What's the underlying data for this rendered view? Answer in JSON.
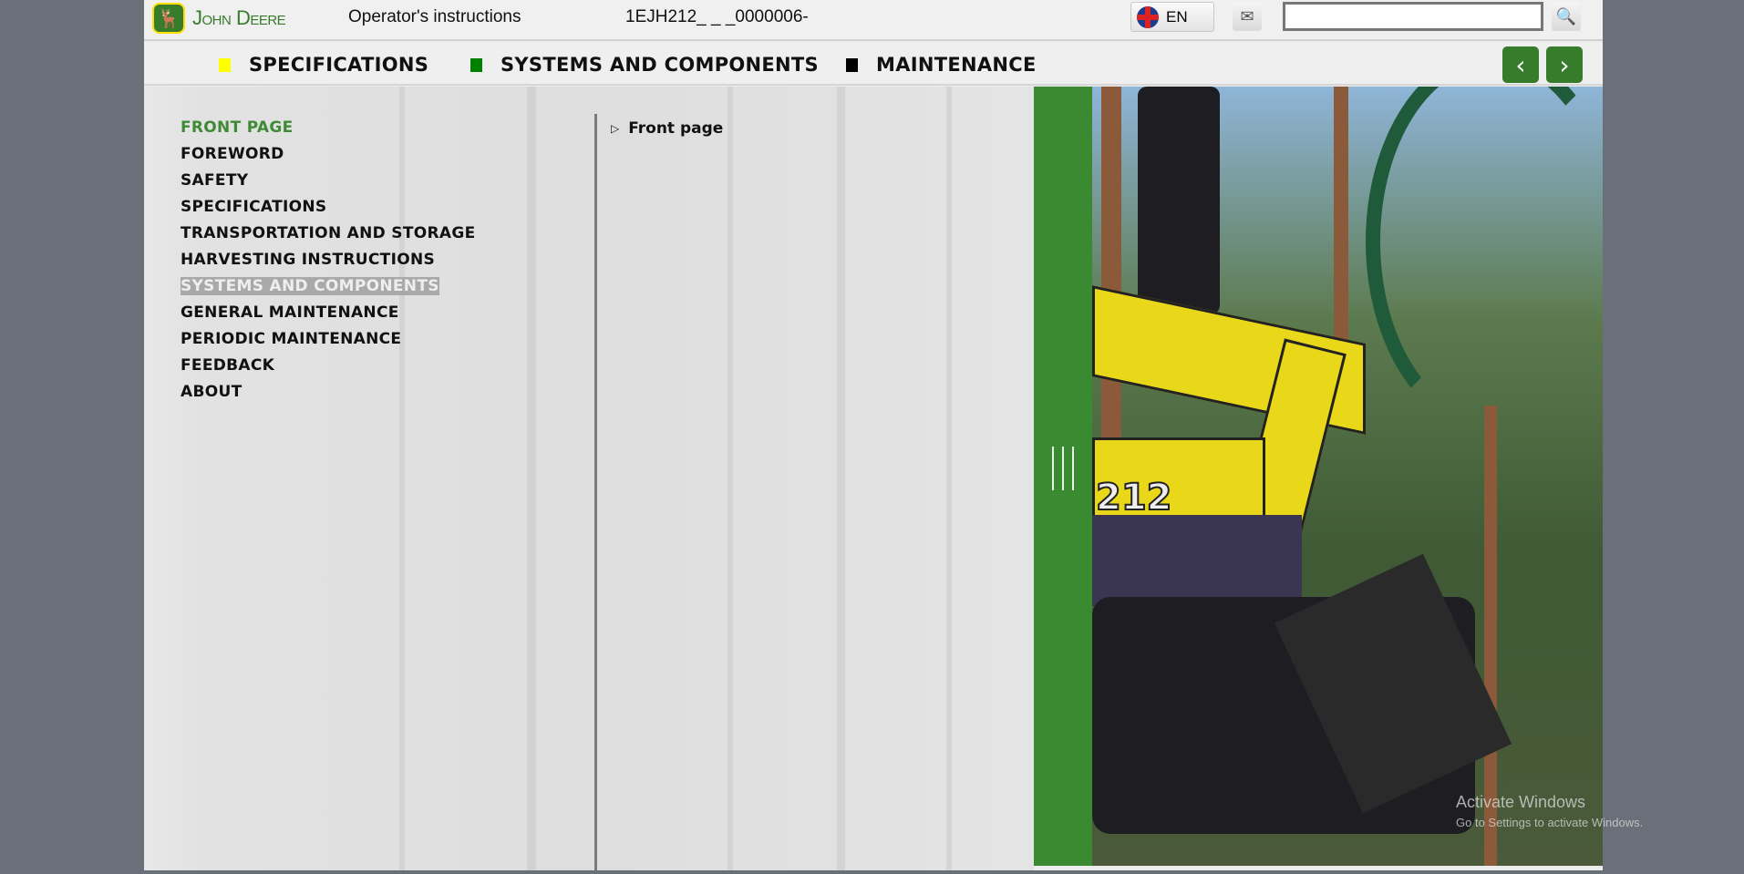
{
  "header": {
    "brand": "John Deere",
    "title": "Operator's instructions",
    "doc_code": "1EJH212_ _ _0000006-",
    "language": "EN",
    "search": {
      "value": "",
      "placeholder": ""
    }
  },
  "nav": {
    "items": [
      {
        "label": "SPECIFICATIONS",
        "color": "#ffff00"
      },
      {
        "label": "SYSTEMS AND COMPONENTS",
        "color": "#008000"
      },
      {
        "label": "MAINTENANCE",
        "color": "#000000"
      }
    ]
  },
  "menu": {
    "items": [
      {
        "label": "FRONT PAGE",
        "state": "active"
      },
      {
        "label": "FOREWORD"
      },
      {
        "label": "SAFETY"
      },
      {
        "label": "SPECIFICATIONS"
      },
      {
        "label": "TRANSPORTATION AND STORAGE"
      },
      {
        "label": "HARVESTING INSTRUCTIONS"
      },
      {
        "label": "SYSTEMS AND COMPONENTS",
        "state": "highlighted"
      },
      {
        "label": "GENERAL MAINTENANCE"
      },
      {
        "label": "PERIODIC MAINTENANCE"
      },
      {
        "label": "FEEDBACK"
      },
      {
        "label": "ABOUT"
      }
    ]
  },
  "breadcrumb": {
    "label": "Front page"
  },
  "photo": {
    "machine_number": "212"
  },
  "watermark": {
    "line1": "Activate Windows",
    "line2": "Go to Settings to activate Windows."
  },
  "colors": {
    "brand_green": "#367c2b",
    "brand_yellow": "#ffde00"
  }
}
